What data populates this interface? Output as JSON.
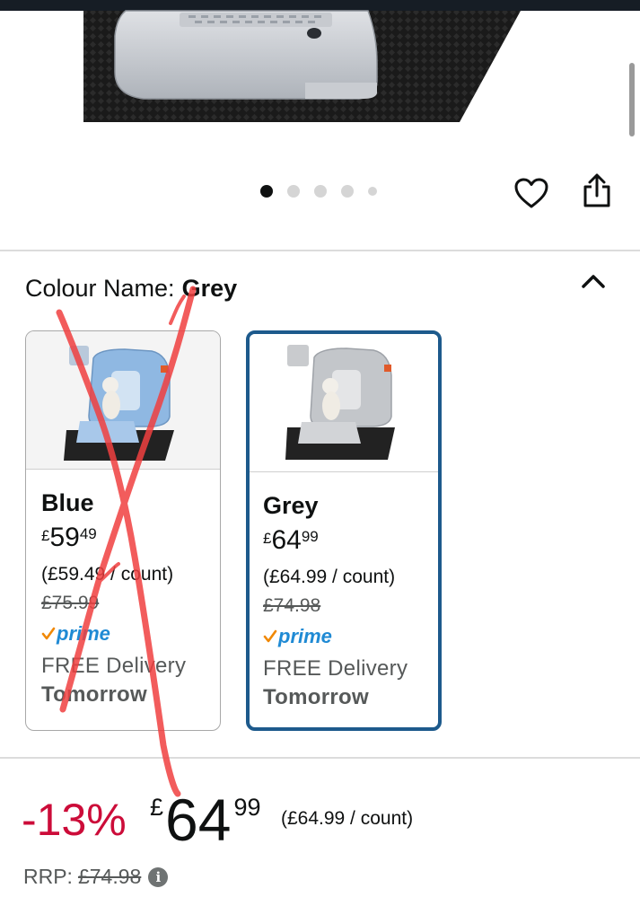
{
  "hero": {
    "image_icon": "litter-box-image",
    "carousel_dots": 5,
    "active_dot": 0
  },
  "actions": {
    "wishlist_icon": "heart-icon",
    "share_icon": "share-icon"
  },
  "variant": {
    "label": "Colour Name:",
    "selected": "Grey",
    "collapse_icon": "chevron-up-icon"
  },
  "options": [
    {
      "name": "Blue",
      "currency": "£",
      "price_whole": "59",
      "price_fraction": "49",
      "unit_price": "(£59.49 / count)",
      "list_price": "£75.99",
      "prime": "prime",
      "delivery": "FREE Delivery",
      "delivery_day": "Tomorrow",
      "selected": false,
      "struck_through": true
    },
    {
      "name": "Grey",
      "currency": "£",
      "price_whole": "64",
      "price_fraction": "99",
      "unit_price": "(£64.99 / count)",
      "list_price": "£74.98",
      "prime": "prime",
      "delivery": "FREE Delivery",
      "delivery_day": "Tomorrow",
      "selected": true,
      "struck_through": false
    }
  ],
  "price_block": {
    "discount": "-13%",
    "currency": "£",
    "price_whole": "64",
    "price_fraction": "99",
    "unit_price": "(£64.99 / count)",
    "rrp_label": "RRP:",
    "rrp_value": "£74.98",
    "info_icon": "info-icon"
  },
  "colors": {
    "accent_border": "#1d5a8c",
    "discount_red": "#cc0c39",
    "prime_blue": "#1f8ad4",
    "prime_check": "#f08804",
    "scribble_red": "#f04040"
  }
}
